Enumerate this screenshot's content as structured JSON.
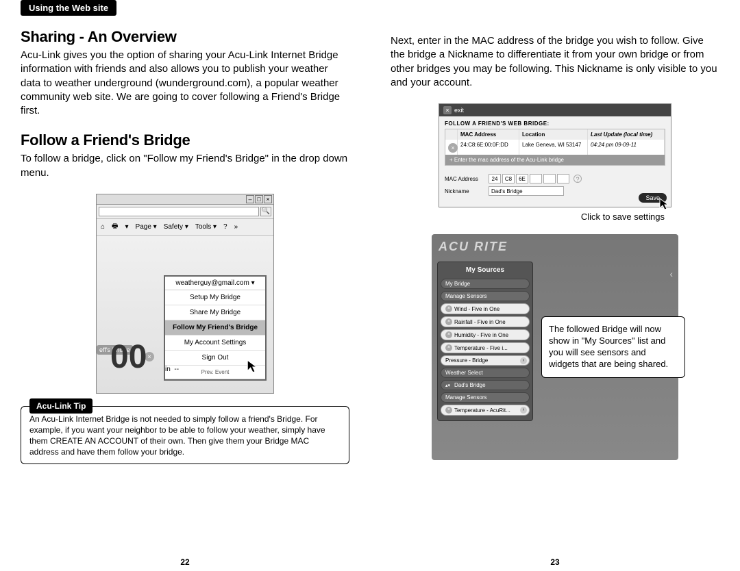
{
  "header_tab": "Using the Web site",
  "left": {
    "h1": "Sharing - An Overview",
    "p1": "Acu-Link gives you the option of sharing your Acu-Link Internet Bridge information with friends and also allows you to publish your weather data to weather underground (wunderground.com), a popular weather community web site. We are going to cover following a Friend's Bridge first.",
    "h2": "Follow a Friend's Bridge",
    "p2": "To follow a bridge, click on \"Follow my Friend's Bridge\" in the drop down menu.",
    "screenshot1": {
      "toolbar": {
        "page": "Page ▾",
        "safety": "Safety ▾",
        "tools": "Tools ▾"
      },
      "account": "weatherguy@gmail.com",
      "menu": {
        "setup": "Setup My Bridge",
        "share": "Share My Bridge",
        "follow": "Follow My Friend's Bridge",
        "settings": "My Account Settings",
        "signout": "Sign Out",
        "prev": "Prev. Event"
      },
      "left_label": "eff's Bridge",
      "big": "00",
      "unit": "in",
      "dashes": "--"
    },
    "tip_label": "Acu-Link Tip",
    "tip_text": "An Acu-Link Internet Bridge is not needed to simply follow a friend's Bridge. For example, if you want your neighbor to be able to follow your weather, simply have them CREATE AN ACCOUNT of their own. Then give them your Bridge MAC address and have them follow your bridge.",
    "page_num": "22"
  },
  "right": {
    "p1": "Next, enter in the MAC address of the bridge you wish to follow. Give the bridge a Nickname to differentiate it from your own bridge or from other bridges you may be following. This Nickname is only visible to you and your account.",
    "screenshot2": {
      "exit": "exit",
      "header": "FOLLOW A FRIEND'S WEB BRIDGE:",
      "cols": {
        "mac": "MAC Address",
        "loc": "Location",
        "upd": "Last Update (local time)"
      },
      "row": {
        "mac": "24:C8:6E:00:0F:DD",
        "loc": "Lake Geneva, WI 53147",
        "upd": "04:24 pm 09-09-11"
      },
      "addrow": "+  Enter the mac address of the Acu-Link bridge",
      "form": {
        "mac_label": "MAC Address",
        "mac1": "24",
        "mac2": "C8",
        "mac3": "6E",
        "q": "?",
        "nick_label": "Nickname",
        "nick_val": "Dad's Bridge"
      },
      "save": "Save"
    },
    "caption2": "Click to save settings",
    "screenshot3": {
      "brand": "ACU RITE",
      "panel_title": "My Sources",
      "items": {
        "mybridge": "My Bridge",
        "manage1": "Manage Sensors",
        "wind": "Wind - Five in One",
        "rain": "Rainfall - Five in One",
        "hum": "Humidity - Five in One",
        "temp": "Temperature - Five i...",
        "press": "Pressure - Bridge",
        "wsel": "Weather Select",
        "dad": "Dad's Bridge",
        "manage2": "Manage Sensors",
        "temp2": "Temperature - AcuRit..."
      }
    },
    "callout": "The followed Bridge will now show in \"My Sources\" list and you will see sensors and widgets that are being shared.",
    "page_num": "23"
  }
}
